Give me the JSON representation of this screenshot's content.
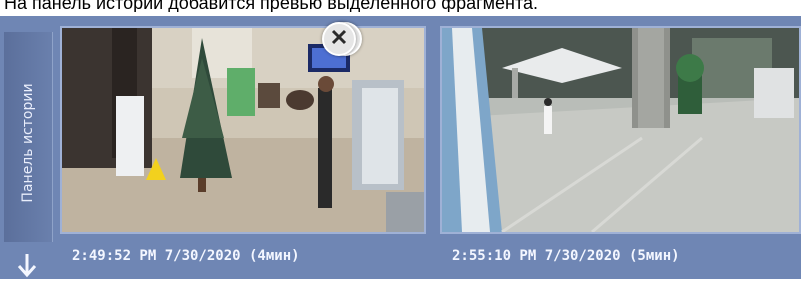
{
  "caption": "На панель истории добавится превью выделенного фрагмента.",
  "side_panel": {
    "label": "Панель истории",
    "arrow_icon": "arrow-down-icon"
  },
  "fragments": [
    {
      "timestamp": "2:49:52 PM 7/30/2020 (4мин)",
      "close_icon": "close-icon"
    },
    {
      "timestamp": "2:55:10 PM 7/30/2020 (5мин)",
      "close_icon": "close-icon"
    }
  ],
  "colors": {
    "panel": "#6f86b4",
    "side_tab": "#5b6f9b",
    "timestamp_text": "#f3f6ff"
  }
}
